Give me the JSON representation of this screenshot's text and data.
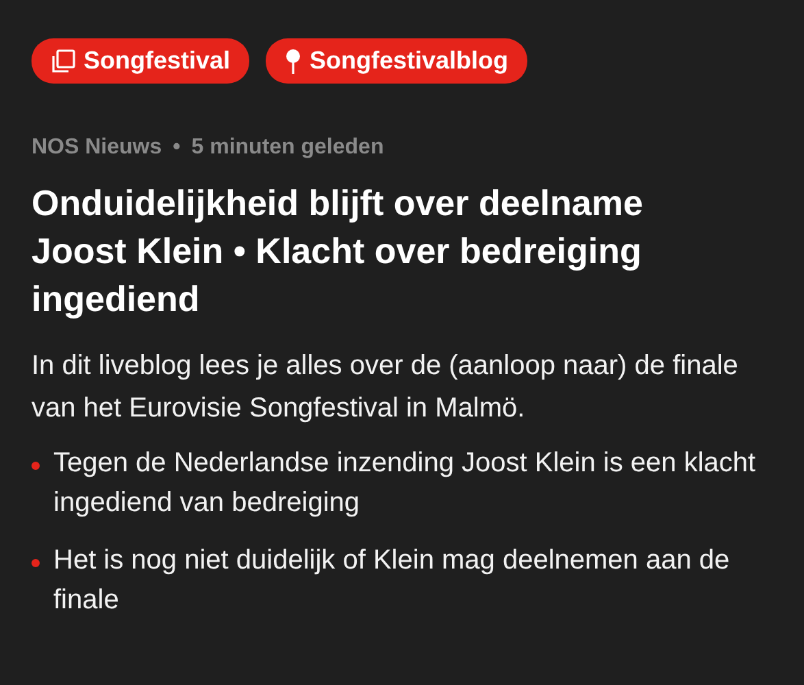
{
  "tags": [
    {
      "label": "Songfestival",
      "kind": "stack"
    },
    {
      "label": "Songfestivalblog",
      "kind": "pin"
    }
  ],
  "meta": {
    "source": "NOS Nieuws",
    "separator": "•",
    "time": "5 minuten geleden"
  },
  "headline": "Onduidelijkheid blijft over deelname Joost Klein • Klacht over bedreiging ingediend",
  "intro": "In dit liveblog lees je alles over de (aanloop naar) de finale van het Eurovisie Songfestival in Malmö.",
  "bullets": [
    "Tegen de Nederlandse inzending Joost Klein is een klacht ingediend van bedreiging",
    "Het is nog niet duidelijk of Klein mag deelnemen aan de finale"
  ]
}
